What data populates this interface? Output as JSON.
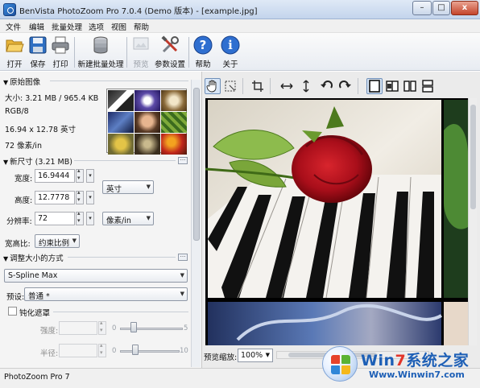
{
  "window": {
    "title": "BenVista PhotoZoom Pro 7.0.4 (Demo 版本) - [example.jpg]",
    "minimize_glyph": "–",
    "maximize_glyph": "□",
    "close_glyph": "x"
  },
  "menu": [
    "文件",
    "编辑",
    "批量处理",
    "选项",
    "视图",
    "帮助"
  ],
  "toolbar": {
    "buttons": [
      {
        "label": "打开",
        "icon": "folder-open-icon"
      },
      {
        "label": "保存",
        "icon": "floppy-disk-icon"
      },
      {
        "label": "打印",
        "icon": "printer-icon"
      },
      {
        "label": "新建批量处理",
        "icon": "database-stack-icon"
      },
      {
        "label": "预览",
        "icon": "preview-icon",
        "disabled": true
      },
      {
        "label": "参数设置",
        "icon": "tools-icon"
      },
      {
        "label": "帮助",
        "icon": "help-icon"
      },
      {
        "label": "关于",
        "icon": "info-icon"
      }
    ]
  },
  "original_image": {
    "header": "原始图像",
    "size": "大小: 3.21 MB / 965.4 KB",
    "mode": "RGB/8",
    "dimensions": "16.94 x 12.78 英寸",
    "resolution": "72 像素/in"
  },
  "new_size": {
    "header": "新尺寸 (3.21 MB)",
    "width_label": "宽度:",
    "width_value": "16.9444",
    "height_label": "高度:",
    "height_value": "12.7778",
    "resolution_label": "分辨率:",
    "resolution_value": "72",
    "unit_size": "英寸",
    "unit_resolution": "像素/in",
    "aspect_label": "宽高比:",
    "aspect_value": "约束比例"
  },
  "resize_method": {
    "header": "调整大小的方式",
    "method": "S-Spline Max",
    "preset_label": "预设:",
    "preset_value": "普通 *"
  },
  "sharpen": {
    "label": "钝化遮罩",
    "checked": false,
    "strength_label": "强度:",
    "strength_min": "0",
    "strength_max": "5",
    "radius_label": "半径:",
    "radius_min": "0",
    "radius_max": "10"
  },
  "preview": {
    "zoom_label": "预览缩放:",
    "zoom_value": "100%"
  },
  "status": {
    "text": "PhotoZoom Pro 7"
  },
  "watermark": {
    "title_prefix": "Win",
    "title_seven": "7",
    "title_suffix": "系统之家",
    "url": "Www.Winwin7.com"
  }
}
